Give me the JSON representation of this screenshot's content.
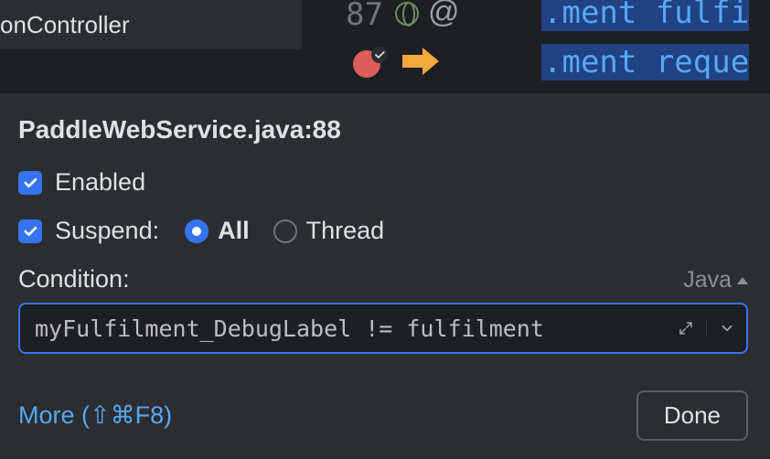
{
  "editor": {
    "tab_label_fragment": "onController",
    "line_number": "87",
    "code_line_1": ".ment fulfi",
    "code_line_2": ".ment reque"
  },
  "breakpoint": {
    "title": "PaddleWebService.java:88",
    "enabled_label": "Enabled",
    "suspend_label": "Suspend:",
    "suspend_options": {
      "all": "All",
      "thread": "Thread"
    },
    "condition_label": "Condition:",
    "language_label": "Java",
    "condition_value": "myFulfilment_DebugLabel != fulfilment",
    "more_label": "More (⇧⌘F8)",
    "done_label": "Done"
  },
  "icons": {
    "globe": "globe-icon",
    "at": "@",
    "breakpoint": "breakpoint-icon",
    "check": "check-icon",
    "arrow_right": "arrow-right-icon",
    "expand": "expand-icon",
    "chevron_down": "chevron-down-icon"
  },
  "colors": {
    "accent": "#3574f0",
    "background": "#2b2d30",
    "editor_bg": "#1e1f22",
    "selection_bg": "#214283",
    "link": "#56a8f5",
    "breakpoint_red": "#db5c5c",
    "arrow_yellow": "#f2a93b"
  }
}
